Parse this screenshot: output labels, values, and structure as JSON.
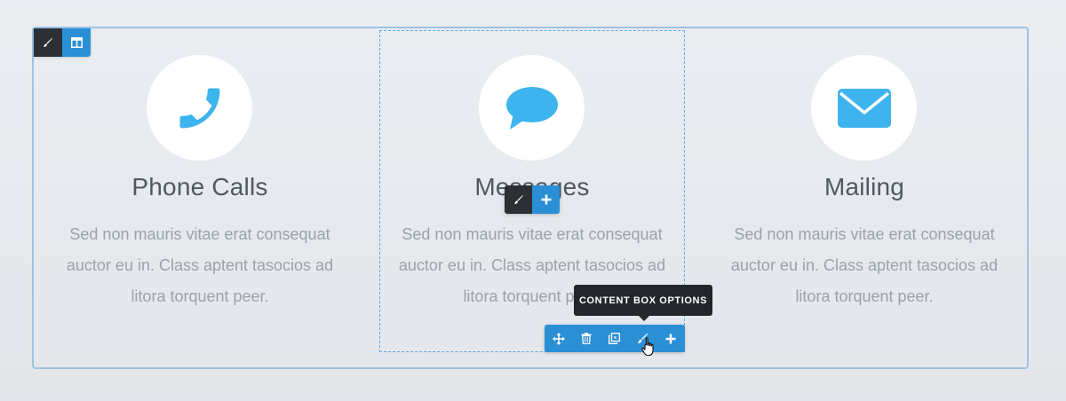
{
  "columns": [
    {
      "title": "Phone Calls",
      "text": "Sed non mauris vitae erat consequat auctor eu in. Class aptent tasocios ad litora torquent peer.",
      "icon": "phone-icon"
    },
    {
      "title": "Messages",
      "text": "Sed non mauris vitae erat consequat auctor eu in. Class aptent tasocios ad litora torquent peer.",
      "icon": "chat-bubble-icon"
    },
    {
      "title": "Mailing",
      "text": "Sed non mauris vitae erat consequat auctor eu in. Class aptent tasocios ad litora torquent peer.",
      "icon": "envelope-icon"
    }
  ],
  "tooltip": {
    "label": "CONTENT BOX OPTIONS"
  },
  "section_toolbar": {
    "items": [
      "brush-icon",
      "columns-layout-icon"
    ]
  },
  "inline_toolbar": {
    "items": [
      "brush-icon",
      "plus-icon"
    ]
  },
  "box_toolbar": {
    "items": [
      "move-icon",
      "trash-icon",
      "duplicate-icon",
      "edit-icon",
      "plus-icon"
    ]
  },
  "colors": {
    "accent": "#2b8fd6",
    "icon": "#3db4ee",
    "dark_toolbar": "#2c2f33",
    "title": "#4f5863",
    "body_text": "#9aa2ab",
    "frame": "#9cc4e4"
  }
}
